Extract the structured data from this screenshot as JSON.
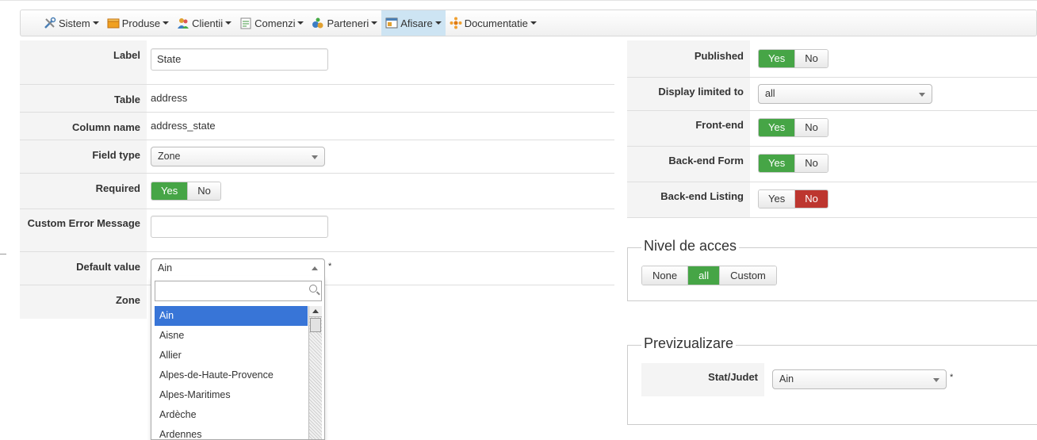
{
  "menubar": {
    "items": [
      {
        "label": "Sistem",
        "icon": "tools-icon"
      },
      {
        "label": "Produse",
        "icon": "box-icon"
      },
      {
        "label": "Clientii",
        "icon": "users-icon"
      },
      {
        "label": "Comenzi",
        "icon": "orders-icon"
      },
      {
        "label": "Parteneri",
        "icon": "partners-icon"
      },
      {
        "label": "Afisare",
        "icon": "display-icon",
        "active": true
      },
      {
        "label": "Documentatie",
        "icon": "help-icon"
      }
    ]
  },
  "form": {
    "label": {
      "label": "Label",
      "value": "State"
    },
    "table": {
      "label": "Table",
      "value": "address"
    },
    "column": {
      "label": "Column name",
      "value": "address_state"
    },
    "field_type": {
      "label": "Field type",
      "value": "Zone"
    },
    "required": {
      "label": "Required",
      "yes": "Yes",
      "no": "No",
      "selected": "Yes"
    },
    "custom_error": {
      "label": "Custom Error Message",
      "value": ""
    },
    "default_value": {
      "label": "Default value",
      "value": "Ain",
      "asterisk": "*"
    },
    "zone": {
      "label": "Zone"
    }
  },
  "dropdown": {
    "search_value": "",
    "options": [
      "Ain",
      "Aisne",
      "Allier",
      "Alpes-de-Haute-Provence",
      "Alpes-Maritimes",
      "Ardèche",
      "Ardennes"
    ],
    "highlighted": "Ain"
  },
  "right": {
    "published": {
      "label": "Published",
      "yes": "Yes",
      "no": "No",
      "selected": "Yes"
    },
    "display_limited": {
      "label": "Display limited to",
      "value": "all"
    },
    "frontend": {
      "label": "Front-end",
      "yes": "Yes",
      "no": "No",
      "selected": "Yes"
    },
    "backend_form": {
      "label": "Back-end Form",
      "yes": "Yes",
      "no": "No",
      "selected": "Yes"
    },
    "backend_listing": {
      "label": "Back-end Listing",
      "yes": "Yes",
      "no": "No",
      "selected": "No"
    }
  },
  "access": {
    "legend": "Nivel de acces",
    "options": [
      "None",
      "all",
      "Custom"
    ],
    "selected": "all"
  },
  "preview": {
    "legend": "Previzualizare",
    "label": "Stat/Judet",
    "value": "Ain",
    "asterisk": "*"
  },
  "colors": {
    "green": "#46a546",
    "red": "#bd362f",
    "highlight": "#3875d7",
    "menu_active": "#cde4f3"
  }
}
